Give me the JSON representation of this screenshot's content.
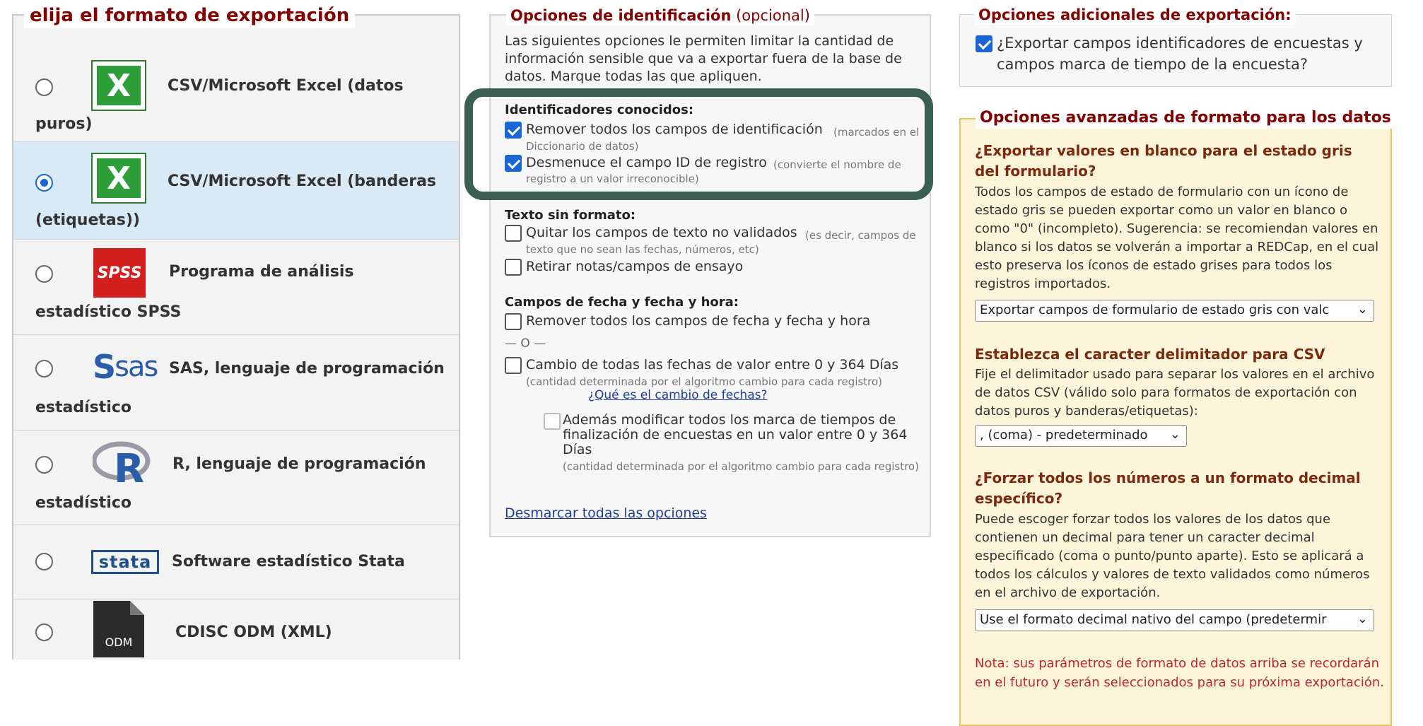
{
  "export_format": {
    "legend": "elija el formato de exportación",
    "options": [
      {
        "line1": "CSV/Microsoft Excel (datos",
        "line2": "puros)",
        "icon": "excel-icon",
        "selected": false
      },
      {
        "line1": "CSV/Microsoft Excel (banderas",
        "line2": "(etiquetas))",
        "icon": "excel-icon",
        "selected": true
      },
      {
        "line1": "Programa de análisis",
        "line2": "estadístico SPSS",
        "icon": "spss-icon",
        "selected": false
      },
      {
        "line1": "SAS, lenguaje de programación",
        "line2": "estadístico",
        "icon": "sas-icon",
        "selected": false
      },
      {
        "line1": "R, lenguaje de programación",
        "line2": "estadístico",
        "icon": "r-icon",
        "selected": false
      },
      {
        "line1": "Software estadístico Stata",
        "line2": "",
        "icon": "stata-icon",
        "selected": false
      },
      {
        "line1": "CDISC ODM (XML)",
        "line2": "",
        "icon": "odm-icon",
        "selected": false
      }
    ],
    "icon_text": {
      "excel": "X",
      "spss": "SPSS",
      "sas": "sas",
      "r": "R",
      "stata": "stata",
      "odm": "ODM"
    }
  },
  "identification": {
    "legend_title": "Opciones de identificación",
    "legend_optional": "(opcional)",
    "intro": "Las siguientes opciones le permiten limitar la cantidad de información sensible que va a exportar fuera de la base de datos. Marque todas las que apliquen.",
    "known_identifiers_heading": "Identificadores conocidos:",
    "remove_identifiers": {
      "label": "Remover todos los campos de identificación",
      "note": "(marcados en el Diccionario de datos)",
      "checked": true
    },
    "hash_record_id": {
      "label": "Desmenuce el campo ID de registro",
      "note": "(convierte el nombre de registro a un valor irreconocible)",
      "checked": true
    },
    "free_text_heading": "Texto sin formato:",
    "remove_unvalidated": {
      "label": "Quitar los campos de texto no validados",
      "note": "(es decir, campos de texto que no sean las fechas, números, etc)",
      "checked": false
    },
    "remove_notes": {
      "label": "Retirar notas/campos de ensayo",
      "checked": false
    },
    "date_heading": "Campos de fecha y fecha y hora:",
    "remove_dates": {
      "label": "Remover todos los campos de fecha y fecha y hora",
      "checked": false
    },
    "or_separator": "— O —",
    "shift_dates": {
      "label": "Cambio de todas las fechas de valor entre 0 y 364 Días",
      "note": "(cantidad determinada por el algoritmo cambio para cada registro)",
      "link": "¿Qué es el cambio de fechas?",
      "checked": false
    },
    "shift_timestamps": {
      "label": "Además modificar todos los marca de tiempos de finalización de encuestas en un valor entre 0 y 364 Días",
      "note": "(cantidad determinada por el algoritmo cambio para cada registro)",
      "checked": false
    },
    "uncheck_all": "Desmarcar todas las opciones"
  },
  "additional": {
    "legend": "Opciones adicionales de exportación:",
    "export_survey_fields": {
      "label": "¿Exportar campos identificadores de encuestas y campos marca de tiempo de la encuesta?",
      "checked": true
    }
  },
  "advanced": {
    "legend": "Opciones avanzadas de formato para los datos",
    "blank_gray": {
      "heading": "¿Exportar valores en blanco para el estado gris del formulario?",
      "text": "Todos los campos de estado de formulario con un ícono de estado gris se pueden exportar como un valor en blanco o como \"0\" (incompleto). Sugerencia: se recomiendan valores en blanco si los datos se volverán a importar a REDCap, en el cual esto preserva los íconos de estado grises para todos los registros importados.",
      "select_value": "Exportar campos de formulario de estado gris con valc"
    },
    "delimiter": {
      "heading": "Establezca el caracter delimitador para CSV",
      "text": "Fije el delimitador usado para separar los valores en el archivo de datos CSV (válido solo para formatos de exportación con datos puros y banderas/etiquetas):",
      "select_value": ", (coma) - predeterminado"
    },
    "decimal": {
      "heading": "¿Forzar todos los números a un formato decimal específico?",
      "text": "Puede escoger forzar todos los valores de los datos que contienen un decimal para tener un caracter decimal especificado (coma o punto/punto aparte). Esto se aplicará a todos los cálculos y valores de texto validados como números en el archivo de exportación.",
      "select_value": "Use el formato decimal nativo del campo (predetermir"
    },
    "note": "Nota: sus parámetros de formato de datos arriba se recordarán en el futuro y serán seleccionados para su próxima exportación."
  },
  "colors": {
    "accent_dark_red": "#800000",
    "checkbox_blue": "#1a66d4",
    "highlight_green": "#3b5e52",
    "advanced_bg": "#fdf5da",
    "note_red": "#c0262d"
  }
}
